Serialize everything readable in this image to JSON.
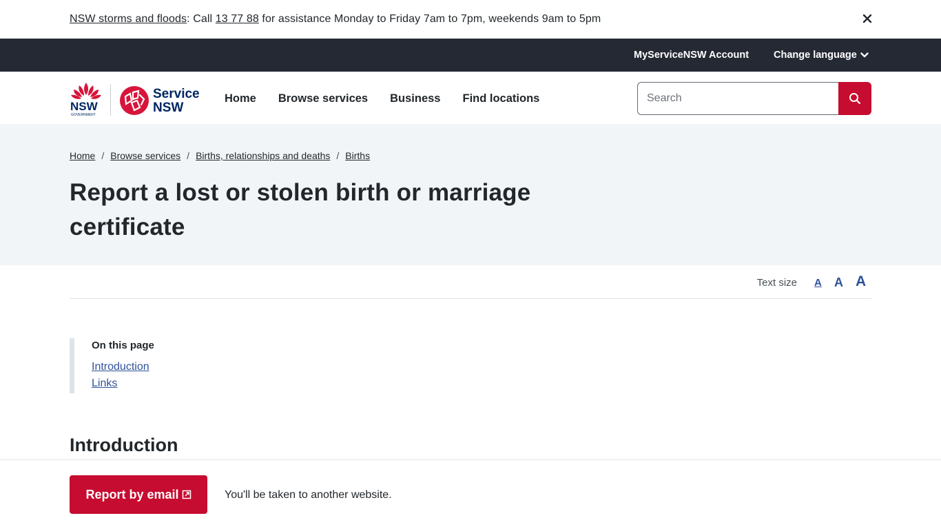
{
  "alert": {
    "link_text": "NSW storms and floods",
    "text_mid": ": Call ",
    "phone": "13 77 88",
    "text_end": " for assistance Monday to Friday 7am to 7pm, weekends 9am to 5pm",
    "close_icon": "close-icon"
  },
  "utility": {
    "account_label": "MyServiceNSW Account",
    "language_label": "Change language",
    "language_icon": "chevron-down-icon"
  },
  "header": {
    "logo_nsw_text": "NSW",
    "logo_nsw_sub": "GOVERNMENT",
    "logo_service_line1": "Service",
    "logo_service_line2": "NSW",
    "nav": [
      {
        "label": "Home"
      },
      {
        "label": "Browse services"
      },
      {
        "label": "Business"
      },
      {
        "label": "Find locations"
      }
    ],
    "search": {
      "placeholder": "Search",
      "value": ""
    },
    "search_icon": "search-icon"
  },
  "breadcrumb": [
    {
      "label": "Home"
    },
    {
      "label": "Browse services"
    },
    {
      "label": "Births, relationships and deaths"
    },
    {
      "label": "Births"
    }
  ],
  "page": {
    "title": "Report a lost or stolen birth or marriage certificate"
  },
  "text_size": {
    "label": "Text size",
    "small": "A",
    "medium": "A",
    "large": "A"
  },
  "on_this_page": {
    "title": "On this page",
    "links": [
      {
        "label": "Introduction"
      },
      {
        "label": "Links"
      }
    ]
  },
  "section": {
    "heading": "Introduction"
  },
  "sticky": {
    "button_label": "Report by email",
    "button_icon": "external-link-icon",
    "note": "You'll be taken to another website."
  },
  "colors": {
    "brand_red": "#c60c30",
    "dark_bar": "#242934",
    "hero_bg": "#f2f5f8",
    "link_blue": "#2e5299",
    "logo_navy": "#002664"
  }
}
